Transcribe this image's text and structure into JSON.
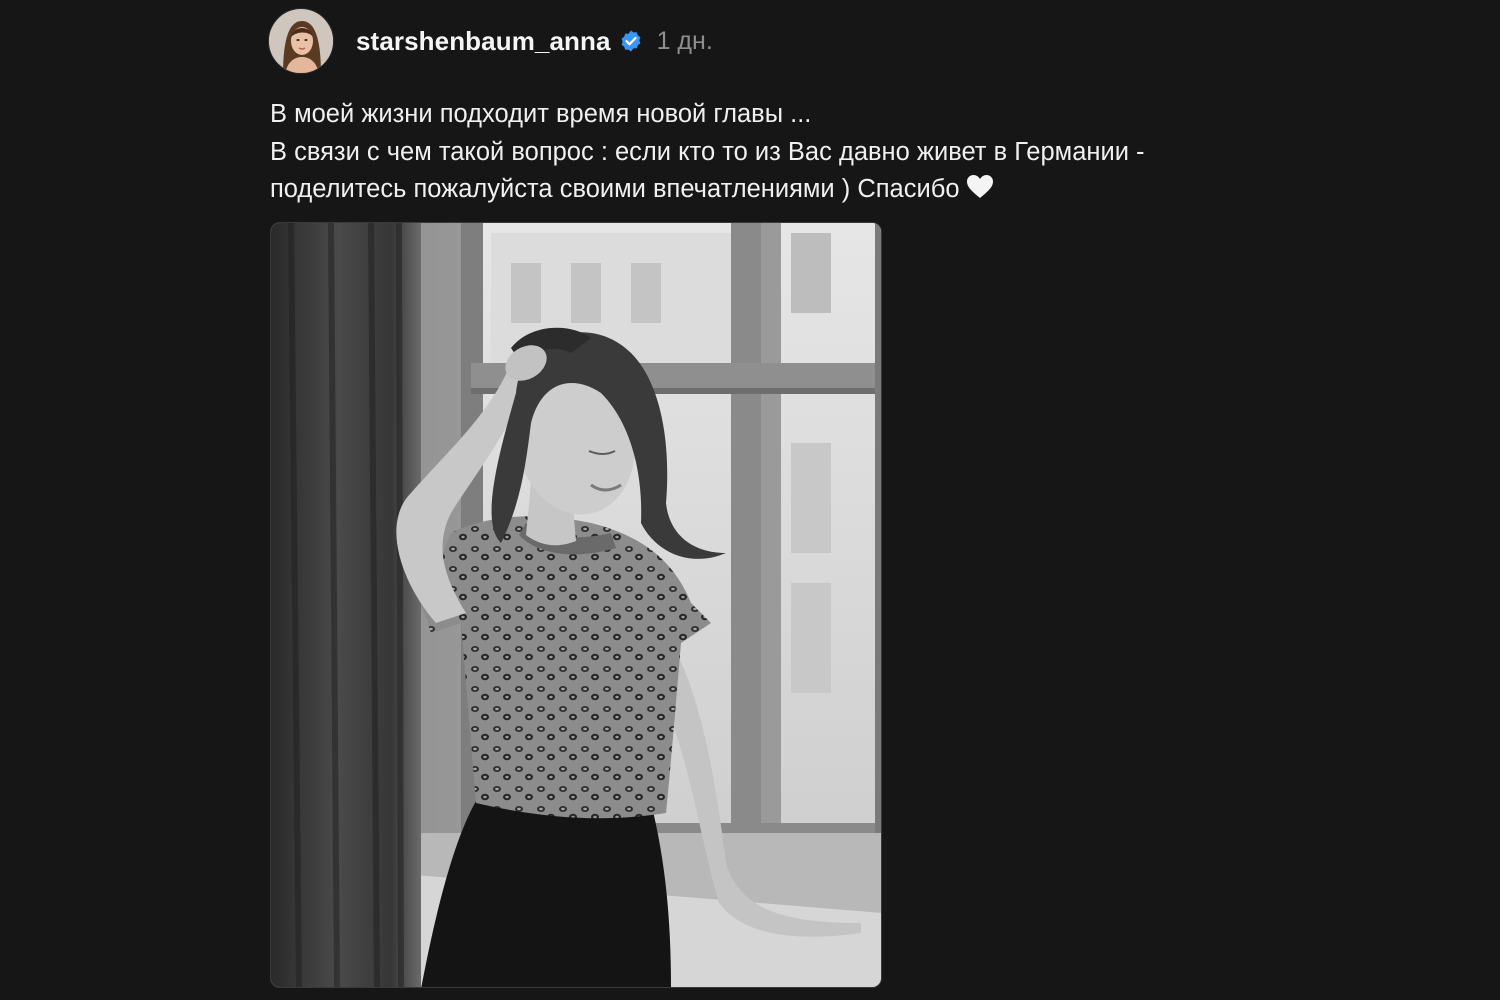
{
  "post": {
    "author": {
      "username": "starshenbaum_anna",
      "verified": true,
      "avatar_icon": "profile-photo"
    },
    "timestamp": "1 дн.",
    "caption_lines": [
      "В моей жизни подходит время новой главы ...",
      "В связи с чем такой вопрос : если кто то из Вас давно живет в Германии -",
      "поделитесь пожалуйста своими впечатлениями ) Спасибо"
    ],
    "caption_emoji": "white-heart-icon",
    "photo": {
      "kind": "black-and-white portrait by a window"
    }
  },
  "colors": {
    "background": "#161616",
    "text": "#f0f0f0",
    "muted": "#8e8e8e",
    "verified_badge": "#3897f0"
  }
}
